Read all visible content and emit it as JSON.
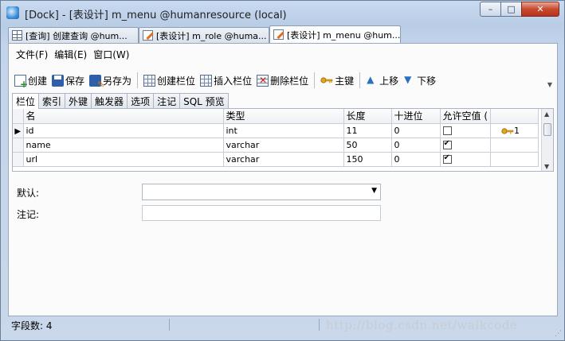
{
  "window": {
    "title": "[Dock] - [表设计] m_menu @humanresource (local)",
    "controls": {
      "minimize": "–",
      "maximize": "□",
      "close": "✕"
    }
  },
  "doc_tabs": [
    {
      "label": "[查询] 创建查询 @hum...",
      "icon": "grid-icon",
      "active": false
    },
    {
      "label": "[表设计] m_role @huma...",
      "icon": "table-design-icon",
      "active": false
    },
    {
      "label": "[表设计] m_menu @hum...",
      "icon": "table-design-icon",
      "active": true
    }
  ],
  "menu": [
    "文件(F)",
    "编辑(E)",
    "窗口(W)"
  ],
  "toolbar": {
    "create": "创建",
    "save": "保存",
    "save_as": "另存为",
    "add_field": "创建栏位",
    "insert_field": "插入栏位",
    "delete_field": "删除栏位",
    "primary_key": "主键",
    "move_up": "上移",
    "move_down": "下移"
  },
  "inner_tabs": [
    "栏位",
    "索引",
    "外键",
    "触发器",
    "选项",
    "注记",
    "SQL 预览"
  ],
  "grid": {
    "columns": [
      "名",
      "类型",
      "长度",
      "十进位",
      "允许空值 (",
      ""
    ],
    "rows": [
      {
        "name": "id",
        "type": "int",
        "length": "11",
        "decimals": "0",
        "allow_null": false,
        "key": "1",
        "current": true
      },
      {
        "name": "name",
        "type": "varchar",
        "length": "50",
        "decimals": "0",
        "allow_null": true,
        "key": "",
        "current": false
      },
      {
        "name": "url",
        "type": "varchar",
        "length": "150",
        "decimals": "0",
        "allow_null": true,
        "key": "",
        "current": false
      }
    ]
  },
  "properties": {
    "default_label": "默认:",
    "default_value": "",
    "comment_label": "注记:",
    "comment_value": ""
  },
  "status": {
    "field_count": "字段数: 4"
  },
  "watermark": "http://blog.csdn.net/walkcode"
}
